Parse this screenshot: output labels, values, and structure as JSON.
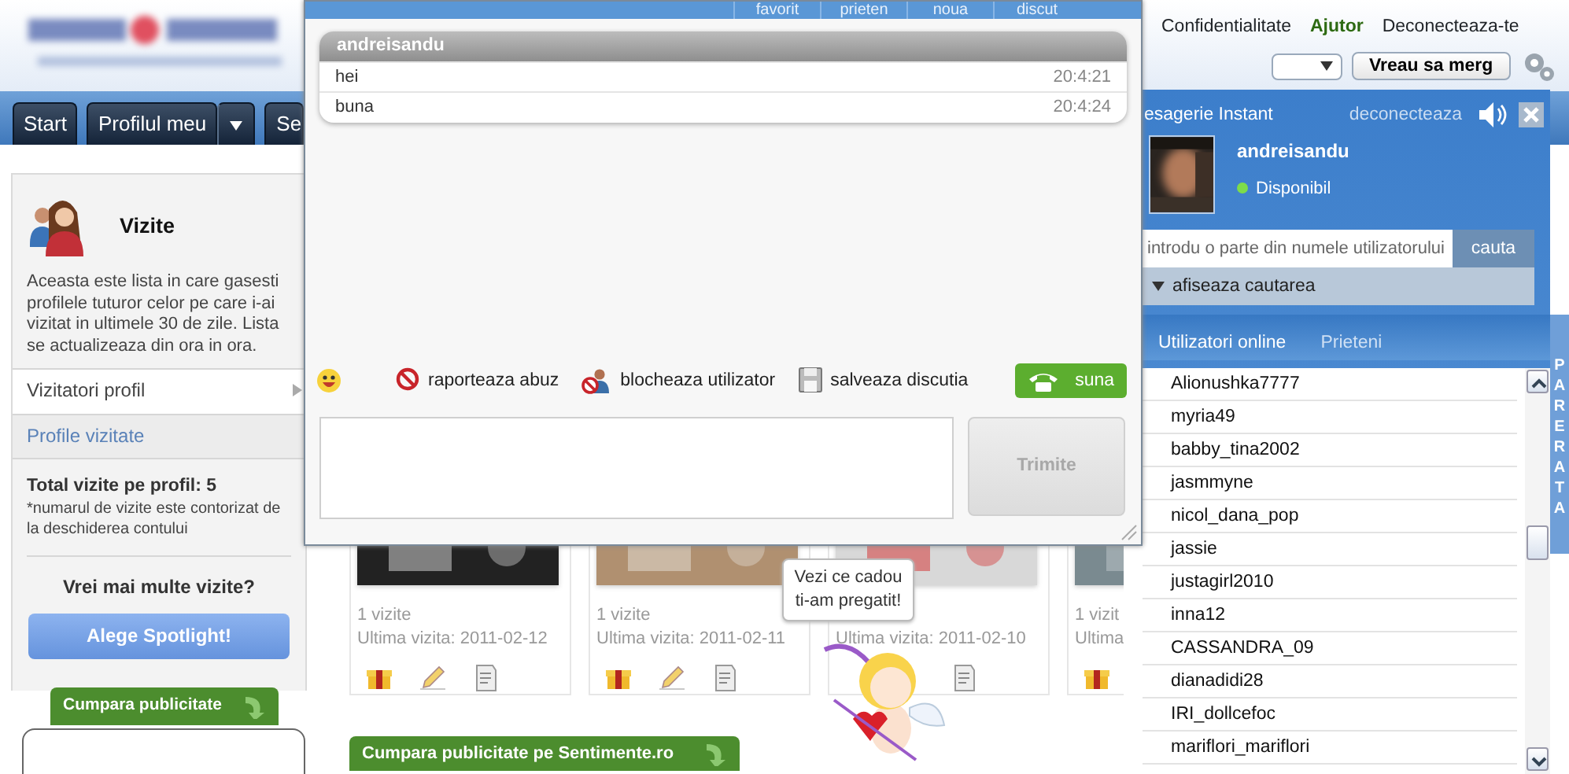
{
  "header": {
    "links": [
      {
        "label": "Confidentialitate",
        "kind": "plain"
      },
      {
        "label": "Ajutor",
        "kind": "strong"
      },
      {
        "label": "Deconecteaza-te",
        "kind": "plain"
      }
    ],
    "go_button": "Vreau sa merg"
  },
  "nav": {
    "tabs": [
      {
        "label": "Start",
        "dropdown": false
      },
      {
        "label": "Profilul meu",
        "dropdown": true
      },
      {
        "label": "Se",
        "dropdown": false
      }
    ]
  },
  "sidebar": {
    "title": "Vizite",
    "description": "Aceasta este lista in care gasesti profilele tuturor celor pe care i-ai vizitat in ultimele 30 de zile. Lista se actualizeaza din ora in ora.",
    "menu": [
      {
        "label": "Vizitatori profil",
        "selected": false
      },
      {
        "label": "Profile vizitate",
        "selected": true
      }
    ],
    "total": "Total vizite pe profil: 5",
    "note": "*numarul de vizite este contorizat de la deschiderea contului",
    "promo_question": "Vrei mai multe vizite?",
    "spotlight_button": "Alege Spotlight!",
    "ad_tab": "Cumpara publicitate"
  },
  "visits": [
    {
      "count": "1 vizite",
      "last": "Ultima vizita: 2011-02-12",
      "actions": [
        {
          "kind": "gift"
        },
        {
          "kind": "pencil"
        },
        {
          "kind": "note"
        }
      ]
    },
    {
      "count": "1 vizite",
      "last": "Ultima vizita: 2011-02-11",
      "actions": [
        {
          "kind": "gift"
        },
        {
          "kind": "pencil"
        },
        {
          "kind": "note"
        }
      ]
    },
    {
      "last": "Ultima vizita: 2011-02-10",
      "actions": [
        {
          "kind": "note"
        }
      ]
    },
    {
      "count": "1 vizit",
      "last": "Ultima",
      "actions": [
        {
          "kind": "gift"
        }
      ]
    }
  ],
  "ad_button": "Cumpara publicitate pe Sentimente.ro",
  "gift_tooltip": "Vezi ce cadou ti-am pregatit!",
  "chat": {
    "top_tabs": [
      "favorit",
      "prieten",
      "noua",
      "discut"
    ],
    "partner": "andreisandu",
    "messages": [
      {
        "text": "hei",
        "time": "20:4:21"
      },
      {
        "text": "buna",
        "time": "20:4:24"
      }
    ],
    "actions": [
      {
        "kind": "report",
        "label": "raporteaza abuz"
      },
      {
        "kind": "block",
        "label": "blocheaza utilizator"
      },
      {
        "kind": "save",
        "label": "salveaza discutia"
      }
    ],
    "call_button": "suna",
    "send_button": "Trimite",
    "send_disabled": true
  },
  "messenger": {
    "title": "esagerie Instant",
    "logout": "deconecteaza",
    "user": "andreisandu",
    "status": "Disponibil",
    "search": {
      "placeholder": "introdu o parte din numele utilizatorului",
      "button": "cauta"
    },
    "toggle": "afiseaza cautarea",
    "tabs": [
      {
        "label": "Utilizatori online",
        "selected": true
      },
      {
        "label": "Prieteni",
        "selected": false
      }
    ],
    "users": [
      "Alionushka7777",
      "myria49",
      "babby_tina2002",
      "jasmmyne",
      "nicol_dana_pop",
      "jassie",
      "justagirl2010",
      "inna12",
      "CASSANDRA_09",
      "dianadidi28",
      "IRI_dollcefoc",
      "mariflori_mariflori"
    ]
  },
  "side_strip": "PARERATA"
}
